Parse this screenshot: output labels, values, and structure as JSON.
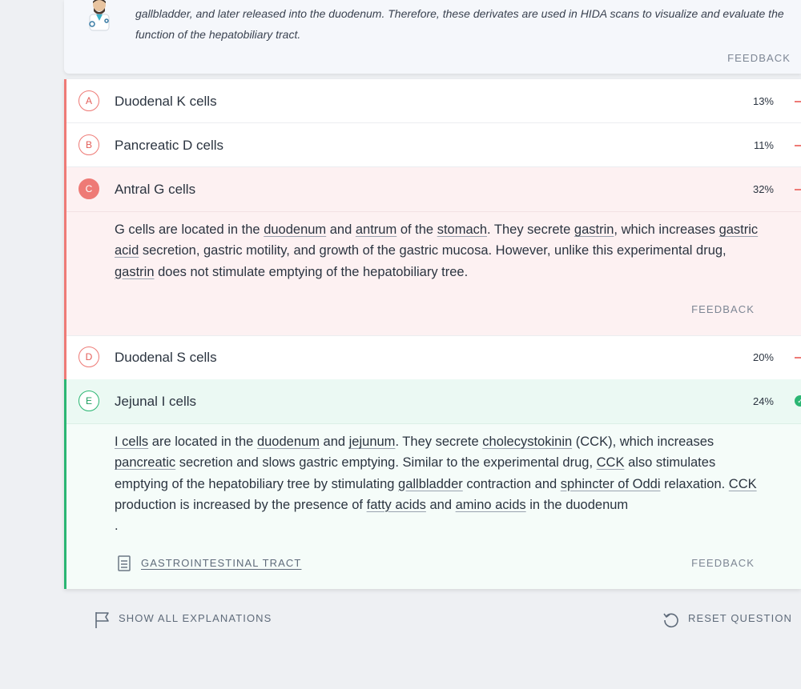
{
  "top": {
    "text_line1": "gallbladder, and later released into the duodenum. Therefore, these derivates are used in HIDA scans to visualize and evaluate the",
    "text_line2": "function of the hepatobiliary tract.",
    "feedback": "FEEDBACK"
  },
  "answers": [
    {
      "letter": "A",
      "text": "Duodenal K cells",
      "percent": "13%"
    },
    {
      "letter": "B",
      "text": "Pancreatic D cells",
      "percent": "11%"
    },
    {
      "letter": "C",
      "text": "Antral G cells",
      "percent": "32%"
    },
    {
      "letter": "D",
      "text": "Duodenal S cells",
      "percent": "20%"
    },
    {
      "letter": "E",
      "text": "Jejunal I cells",
      "percent": "24%"
    }
  ],
  "explanation_c": {
    "p1": "G cells are located in the ",
    "l1": "duodenum",
    "p2": " and ",
    "l2": "antrum",
    "p3": " of the ",
    "l3": "stomach",
    "p4": ". They secrete ",
    "l4": "gastrin",
    "p5": ", which increases ",
    "l5": "gastric acid",
    "p6": " secretion, gastric motility, and growth of the gastric mucosa. However, unlike this experimental drug, ",
    "l6": "gastrin",
    "p7": " does not stimulate emptying of the hepatobiliary tree.",
    "feedback": "FEEDBACK"
  },
  "explanation_e": {
    "l1": "I cells",
    "p1": " are located in the ",
    "l2": "duodenum",
    "p2": " and ",
    "l3": "jejunum",
    "p3": ". They secrete ",
    "l4": "cholecystokinin",
    "p4": " (CCK), which increases ",
    "l5": "pancreatic",
    "p5": " secretion and slows gastric emptying. Similar to the experimental drug, ",
    "l6": "CCK",
    "p6": " also stimulates emptying of the hepatobiliary tree by stimulating ",
    "l7": "gallbladder",
    "p7": " contraction and ",
    "l8": "sphincter of Oddi",
    "p8": " relaxation. ",
    "l9": "CCK",
    "p9": " production is increased by the presence of ",
    "l10": "fatty acids",
    "p10": " and ",
    "l11": "amino acids",
    "p11": " in the duodenum",
    "p12": ".",
    "topic": "GASTROINTESTINAL TRACT",
    "feedback": "FEEDBACK"
  },
  "footer": {
    "show_all": "SHOW ALL EXPLANATIONS",
    "reset": "RESET QUESTION"
  },
  "colors": {
    "incorrect": "#ee7a76",
    "correct": "#2bb673",
    "incorrect_bg": "#fdf1f2",
    "correct_bg": "#ebf9f3",
    "correct_expl_bg": "#f5fcf9"
  },
  "icons": {
    "avatar": "doctor-avatar-icon",
    "topic": "document-icon",
    "show_all": "flag-icon",
    "reset": "reset-icon",
    "correct": "check-icon"
  }
}
